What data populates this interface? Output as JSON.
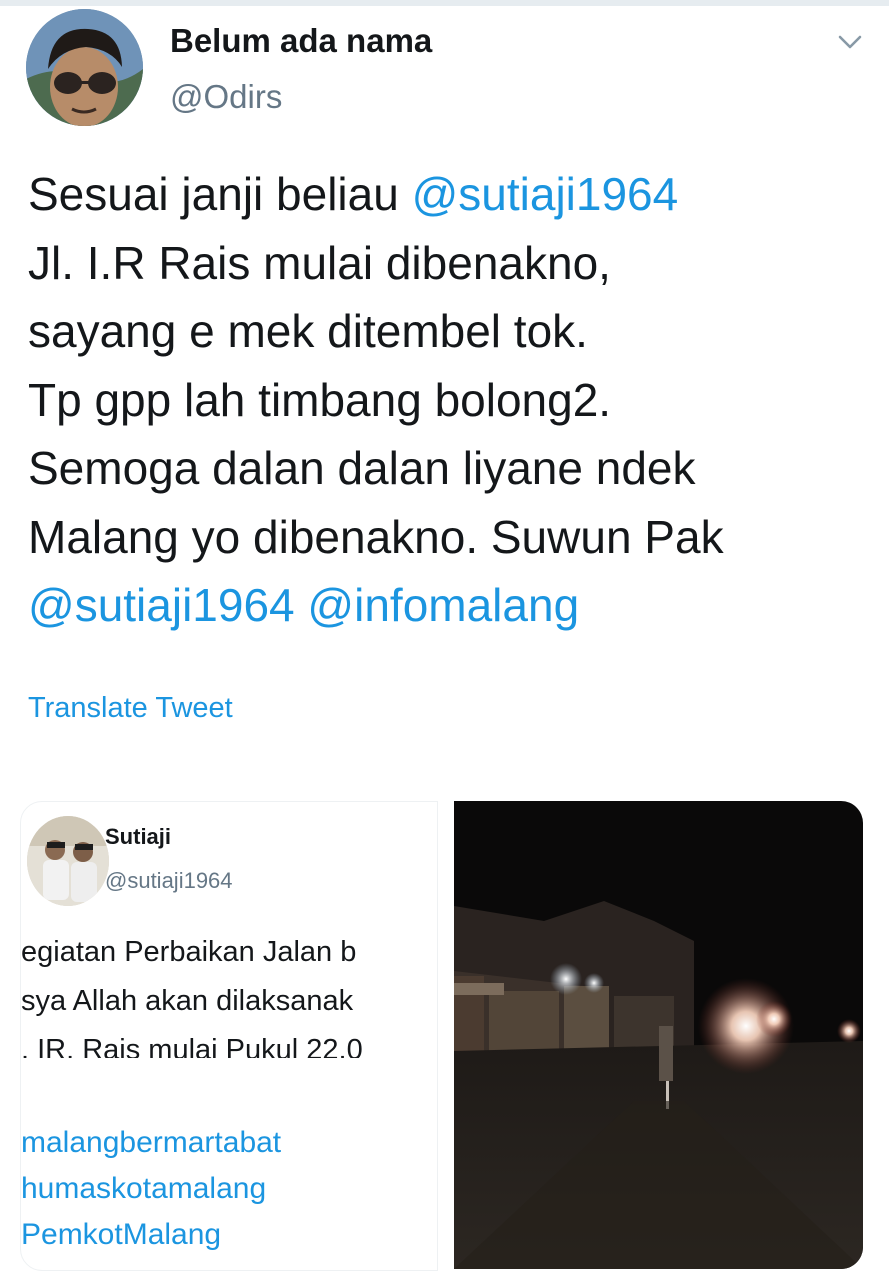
{
  "user": {
    "display_name": "Belum ada nama",
    "handle": "@Odirs"
  },
  "tweet": {
    "lines": [
      [
        {
          "text": "Sesuai janji beliau ",
          "mention": false
        },
        {
          "text": "@sutiaji1964",
          "mention": true
        }
      ],
      [
        {
          "text": "Jl. I.R Rais mulai dibenakno,",
          "mention": false
        }
      ],
      [
        {
          "text": "sayang e mek ditembel tok.",
          "mention": false
        }
      ],
      [
        {
          "text": "Tp gpp lah timbang bolong2.",
          "mention": false
        }
      ],
      [
        {
          "text": "Semoga dalan dalan liyane ndek",
          "mention": false
        }
      ],
      [
        {
          "text": "Malang yo dibenakno. Suwun Pak",
          "mention": false
        }
      ],
      [
        {
          "text": "@sutiaji1964",
          "mention": true
        },
        {
          "text": " ",
          "mention": false
        },
        {
          "text": "@infomalang",
          "mention": true
        }
      ]
    ],
    "translate_label": "Translate Tweet"
  },
  "media": {
    "embedded_screenshot": {
      "name": "Sutiaji",
      "handle": "@sutiaji1964",
      "text_lines": [
        "egiatan Perbaikan Jalan b",
        "sya Allah akan dilaksanak",
        ". IR. Rais mulai Pukul 22.0"
      ],
      "hashtags": [
        "malangbermartabat",
        "humaskotamalang",
        "PemkotMalang"
      ]
    }
  },
  "colors": {
    "link": "#1b95e0",
    "text": "#14171a",
    "muted": "#657786"
  },
  "icons": {
    "menu": "chevron-down-icon"
  }
}
